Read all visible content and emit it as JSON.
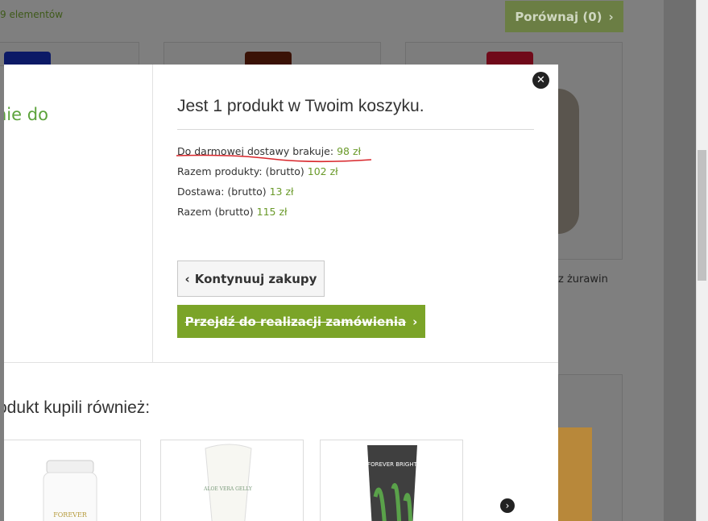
{
  "background": {
    "count_text": "9 elementów",
    "compare_label": "Porównaj (0)",
    "card_text": "z żurawin"
  },
  "modal": {
    "left_text": "nie do",
    "cart_title": "Jest 1 produkt w Twoim koszyku.",
    "rows": [
      {
        "label": "Do darmowej dostawy brakuje:",
        "value": "98 zł"
      },
      {
        "label": "Razem produkty: (brutto)",
        "value": "102 zł"
      },
      {
        "label": "Dostawa: (brutto)",
        "value": "13 zł"
      },
      {
        "label": "Razem (brutto)",
        "value": "115 zł"
      }
    ],
    "continue_label": "Kontynuuj zakupy",
    "checkout_label": "Przejdź do realizacji zamówienia",
    "also_bought_title": "odukt kupili również:",
    "products": [
      {
        "brand": "FOREVER"
      },
      {
        "brand": "ALOE VERA GELLY"
      },
      {
        "brand": "FOREVER BRIGHT"
      }
    ]
  },
  "icons": {
    "close": "close-icon",
    "next": "chevron-right-icon"
  }
}
